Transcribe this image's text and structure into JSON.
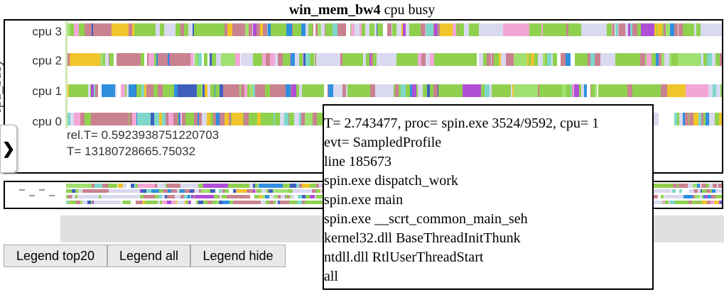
{
  "title": {
    "bold": "win_mem_bw4",
    "rest": "cpu busy"
  },
  "chart_data": {
    "type": "heatmap",
    "ylabel": "cpu_busy",
    "lanes": [
      "cpu 3",
      "cpu 2",
      "cpu 1",
      "cpu 0"
    ],
    "palette": [
      "#8fd14f",
      "#c9828f",
      "#d9d9f0",
      "#2f8fdf",
      "#f2c42c",
      "#b04fd6",
      "#ffffff",
      "#7fd7c9",
      "#f3a6d6",
      "#3f5fbf",
      "#a0e070"
    ]
  },
  "cursor": {
    "rel_t": "rel.T= 0.5923938751220703",
    "t": "T= 13180728665.75032"
  },
  "nav_tab": {
    "icon": "chevron-right-icon",
    "glyph": "❯"
  },
  "tooltip": {
    "lines": [
      "T= 2.743477, proc= spin.exe 3524/9592, cpu= 1",
      "evt= SampledProfile",
      "line 185673",
      "spin.exe dispatch_work",
      "spin.exe main",
      "spin.exe __scrt_common_main_seh",
      "kernel32.dll BaseThreadInitThunk",
      "ntdll.dll RtlUserThreadStart",
      "all"
    ]
  },
  "buttons": {
    "top20": "Legend top20",
    "all": "Legend all",
    "hide": "Legend hide"
  }
}
